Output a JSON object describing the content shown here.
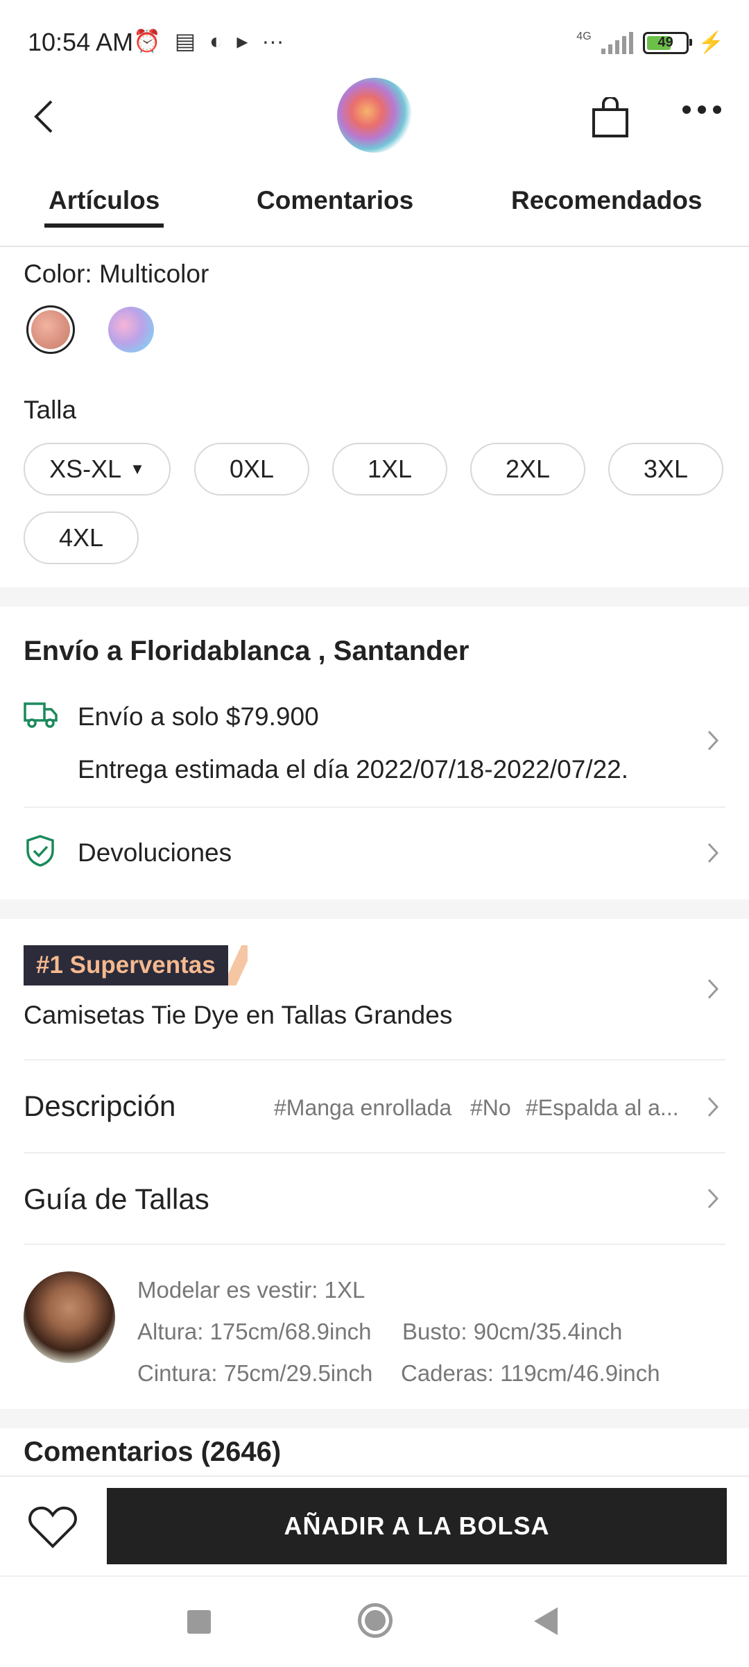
{
  "status_bar": {
    "time": "10:54 AM",
    "network": "4G",
    "battery": "49",
    "icons": [
      "alarm-icon",
      "news-icon",
      "app-icon",
      "play-icon",
      "more-icon"
    ]
  },
  "header": {
    "icons": [
      "back-icon",
      "product-thumbnail",
      "bag-icon",
      "more-icon"
    ]
  },
  "tabs": [
    {
      "label": "Artículos",
      "active": true
    },
    {
      "label": "Comentarios",
      "active": false
    },
    {
      "label": "Recomendados",
      "active": false
    }
  ],
  "color": {
    "label": "Color: Multicolor",
    "swatches": [
      "#d88f7e",
      "#b9a3e8"
    ]
  },
  "size": {
    "label": "Talla",
    "options": [
      "XS-XL",
      "0XL",
      "1XL",
      "2XL",
      "3XL",
      "4XL"
    ]
  },
  "shipping": {
    "title": "Envío a Floridablanca , Santander",
    "price": "Envío a solo $79.900",
    "estimate": "Entrega estimada el día 2022/07/18-2022/07/22.",
    "returns": "Devoluciones"
  },
  "bestseller": {
    "badge": "#1 Superventas",
    "category": "Camisetas Tie Dye en Tallas Grandes"
  },
  "description": {
    "label": "Descripción",
    "tags": [
      "#Manga enrollada",
      "#No",
      "#Espalda al a..."
    ]
  },
  "size_guide": {
    "label": "Guía de Tallas"
  },
  "model": {
    "wearing": "Modelar es vestir: 1XL",
    "height": "Altura: 175cm/68.9inch",
    "bust": "Busto: 90cm/35.4inch",
    "waist": "Cintura: 75cm/29.5inch",
    "hips": "Caderas: 119cm/46.9inch"
  },
  "comments_header": "Comentarios (2646)",
  "bottom_bar": {
    "add_to_bag": "AÑADIR A LA BOLSA"
  },
  "colors": {
    "accent_green": "#1a8a5a",
    "button_dark": "#222222",
    "badge_bg": "#2b2b3a",
    "badge_text": "#f5b98f"
  }
}
